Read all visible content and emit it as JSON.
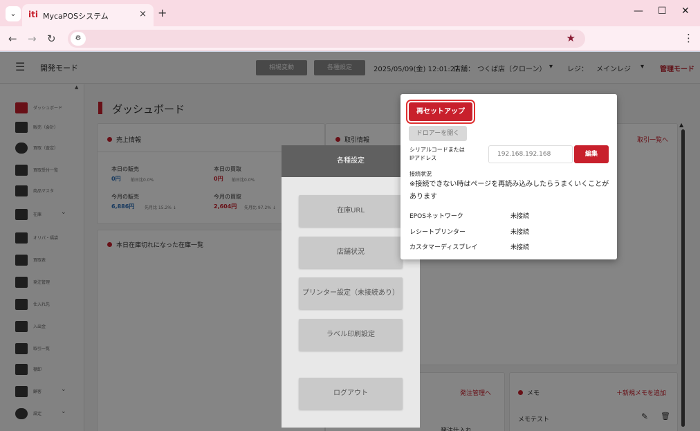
{
  "browser": {
    "tab_title": "MycaPOSシステム",
    "tab_favicon": "iti",
    "close_glyph": "×",
    "newtab_glyph": "+",
    "tabmenu_glyph": "⌄",
    "back_glyph": "←",
    "forward_glyph": "→",
    "reload_glyph": "↻",
    "siteinfo_glyph": "⚙",
    "star_glyph": "★",
    "kebab_glyph": "⋮",
    "minimize_glyph": "—",
    "maximize_glyph": "☐",
    "close_window_glyph": "✕"
  },
  "header": {
    "hamburger_glyph": "☰",
    "mode_title": "開発モード",
    "btn_price_change": "相場変動",
    "btn_settings": "各種設定",
    "datetime": "2025/05/09(金) 12:01:27",
    "store_label": "店舗：",
    "store_value": "つくば店（クローン）",
    "register_label": "レジ：",
    "register_value": "メインレジ",
    "dropdown_glyph": "▾",
    "mgmt_mode": "管理モード"
  },
  "sidebar": {
    "collapse_glyph": "▲",
    "items": [
      {
        "label": "ダッシュボード",
        "icon": "dashboard-icon",
        "active": true
      },
      {
        "label": "販売（会計）",
        "icon": "cart-icon"
      },
      {
        "label": "買取（査定）",
        "icon": "dollar-icon"
      },
      {
        "label": "買取受付一覧",
        "icon": "register-icon"
      },
      {
        "label": "商品マスタ",
        "icon": "store-icon"
      },
      {
        "label": "在庫",
        "icon": "box-icon",
        "chevron": "⌄"
      },
      {
        "label": "オリパ・福袋",
        "icon": "gift-icon"
      },
      {
        "label": "買取表",
        "icon": "table-icon"
      },
      {
        "label": "発注管理",
        "icon": "truck-icon"
      },
      {
        "label": "仕入れ先",
        "icon": "factory-icon"
      },
      {
        "label": "入出金",
        "icon": "cashier-icon"
      },
      {
        "label": "取引一覧",
        "icon": "transaction-icon"
      },
      {
        "label": "棚卸",
        "icon": "clipboard-icon"
      },
      {
        "label": "顧客",
        "icon": "people-icon",
        "chevron": "⌄"
      },
      {
        "label": "設定",
        "icon": "gear-icon",
        "chevron": "⌄"
      }
    ]
  },
  "main": {
    "page_title": "ダッシュボード",
    "sales_card": {
      "title": "売上情報",
      "today_sales_label": "本日の販売",
      "today_sales_value": "0円",
      "today_sales_note": "前日比0.0%",
      "today_buy_label": "本日の買取",
      "today_buy_value": "0円",
      "today_buy_note": "前日比0.0%",
      "month_sales_label": "今月の販売",
      "month_sales_value": "6,886円",
      "month_sales_note": "先月比 15.2% ↓",
      "month_buy_label": "今月の買取",
      "month_buy_value": "2,604円",
      "month_buy_note": "先月比 97.2% ↓"
    },
    "trade_card": {
      "title": "取引情報",
      "link": "取引一覧へ"
    },
    "stockout_card": {
      "title": "本日在庫切れになった在庫一覧"
    },
    "order_card": {
      "link": "発注管理へ",
      "partial_text": "発注仕入れ"
    },
    "memo_card": {
      "title": "メモ",
      "add_link": "＋新規メモを追加",
      "memo_item": "メモテスト",
      "edit_glyph": "✎",
      "delete_glyph": "🗑"
    }
  },
  "settings_panel": {
    "title": "各種設定",
    "buttons": [
      "在庫URL",
      "店舗状況",
      "プリンター設定（未接続あり）",
      "ラベル印刷設定",
      "ログアウト"
    ]
  },
  "modal": {
    "reset_button": "再セットアップ",
    "drawer_button": "ドロアーを開く",
    "serial_label_1": "シリアルコードまたは",
    "serial_label_2": "IPアドレス",
    "ip_placeholder": "192.168.192.168",
    "edit_button": "編集",
    "conn_status_label": "接続状況",
    "note": "※接続できない時はページを再読み込みしたらうまくいくことがあります",
    "devices": [
      {
        "name": "EPOSネットワーク",
        "status": "未接続"
      },
      {
        "name": "レシートプリンター",
        "status": "未接続"
      },
      {
        "name": "カスタマーディスプレイ",
        "status": "未接続"
      }
    ]
  }
}
